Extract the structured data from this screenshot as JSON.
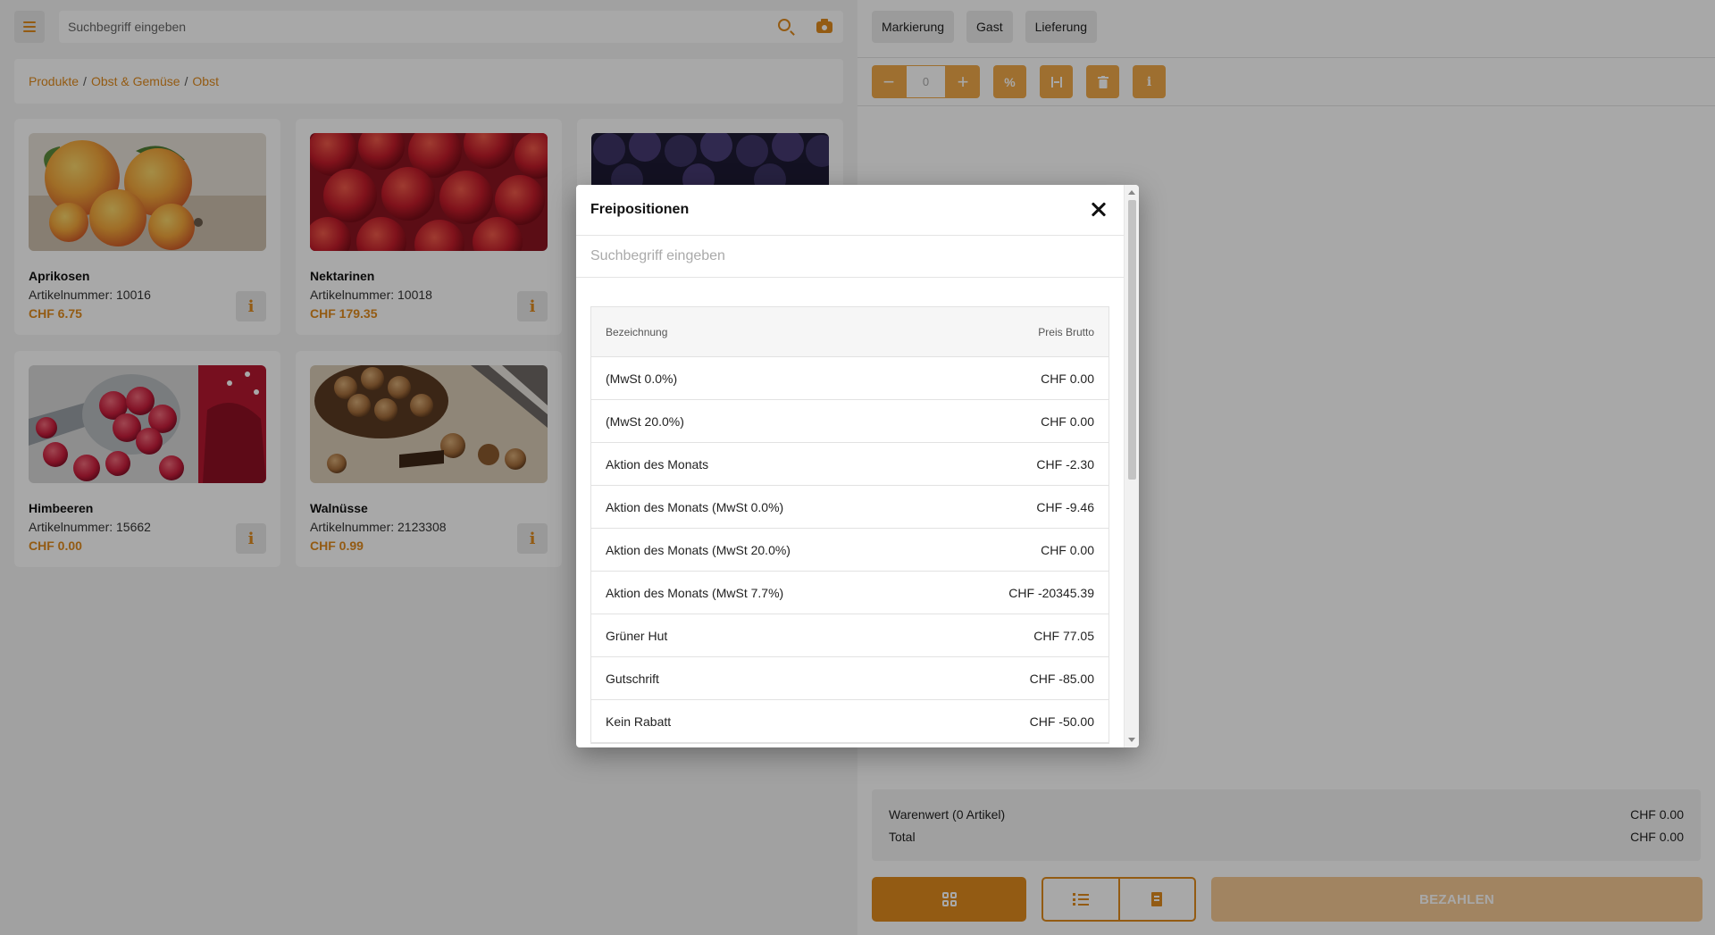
{
  "search": {
    "placeholder": "Suchbegriff eingeben"
  },
  "breadcrumb": [
    "Produkte",
    "Obst & Gemüse",
    "Obst"
  ],
  "products": [
    {
      "name": "Aprikosen",
      "article": "Artikelnummer: 10016",
      "price": "CHF 6.75",
      "image": "apricots"
    },
    {
      "name": "Nektarinen",
      "article": "Artikelnummer: 10018",
      "price": "CHF 179.35",
      "image": "nectarines"
    },
    {
      "name": "",
      "article": "",
      "price": "",
      "image": "plums"
    },
    {
      "name": "Himbeeren",
      "article": "Artikelnummer: 15662",
      "price": "CHF 0.00",
      "image": "raspberries"
    },
    {
      "name": "Walnüsse",
      "article": "Artikelnummer: 2123308",
      "price": "CHF 0.99",
      "image": "walnuts"
    }
  ],
  "tabs": [
    "Markierung",
    "Gast",
    "Lieferung"
  ],
  "quantity": "0",
  "toolbar_icons": [
    "minus-icon",
    "plus-icon",
    "percent-icon",
    "split-icon",
    "trash-icon",
    "info-icon"
  ],
  "summary": {
    "goods_label": "Warenwert (0 Artikel)",
    "goods_value": "CHF 0.00",
    "total_label": "Total",
    "total_value": "CHF 0.00"
  },
  "pay_label": "BEZAHLEN",
  "modal": {
    "title": "Freipositionen",
    "search_placeholder": "Suchbegriff eingeben",
    "col_name": "Bezeichnung",
    "col_price": "Preis Brutto",
    "rows": [
      {
        "name": "(MwSt 0.0%)",
        "price": "CHF 0.00"
      },
      {
        "name": "(MwSt 20.0%)",
        "price": "CHF 0.00"
      },
      {
        "name": "Aktion des Monats",
        "price": "CHF -2.30"
      },
      {
        "name": "Aktion des Monats (MwSt 0.0%)",
        "price": "CHF -9.46"
      },
      {
        "name": "Aktion des Monats (MwSt 20.0%)",
        "price": "CHF 0.00"
      },
      {
        "name": "Aktion des Monats (MwSt 7.7%)",
        "price": "CHF -20345.39"
      },
      {
        "name": "Grüner Hut",
        "price": "CHF 77.05"
      },
      {
        "name": "Gutschrift",
        "price": "CHF -85.00"
      },
      {
        "name": "Kein Rabatt",
        "price": "CHF -50.00"
      }
    ]
  },
  "colors": {
    "accent": "#e08a1e",
    "accent_light": "#f0a94a",
    "pay_disabled": "#f5c894"
  }
}
